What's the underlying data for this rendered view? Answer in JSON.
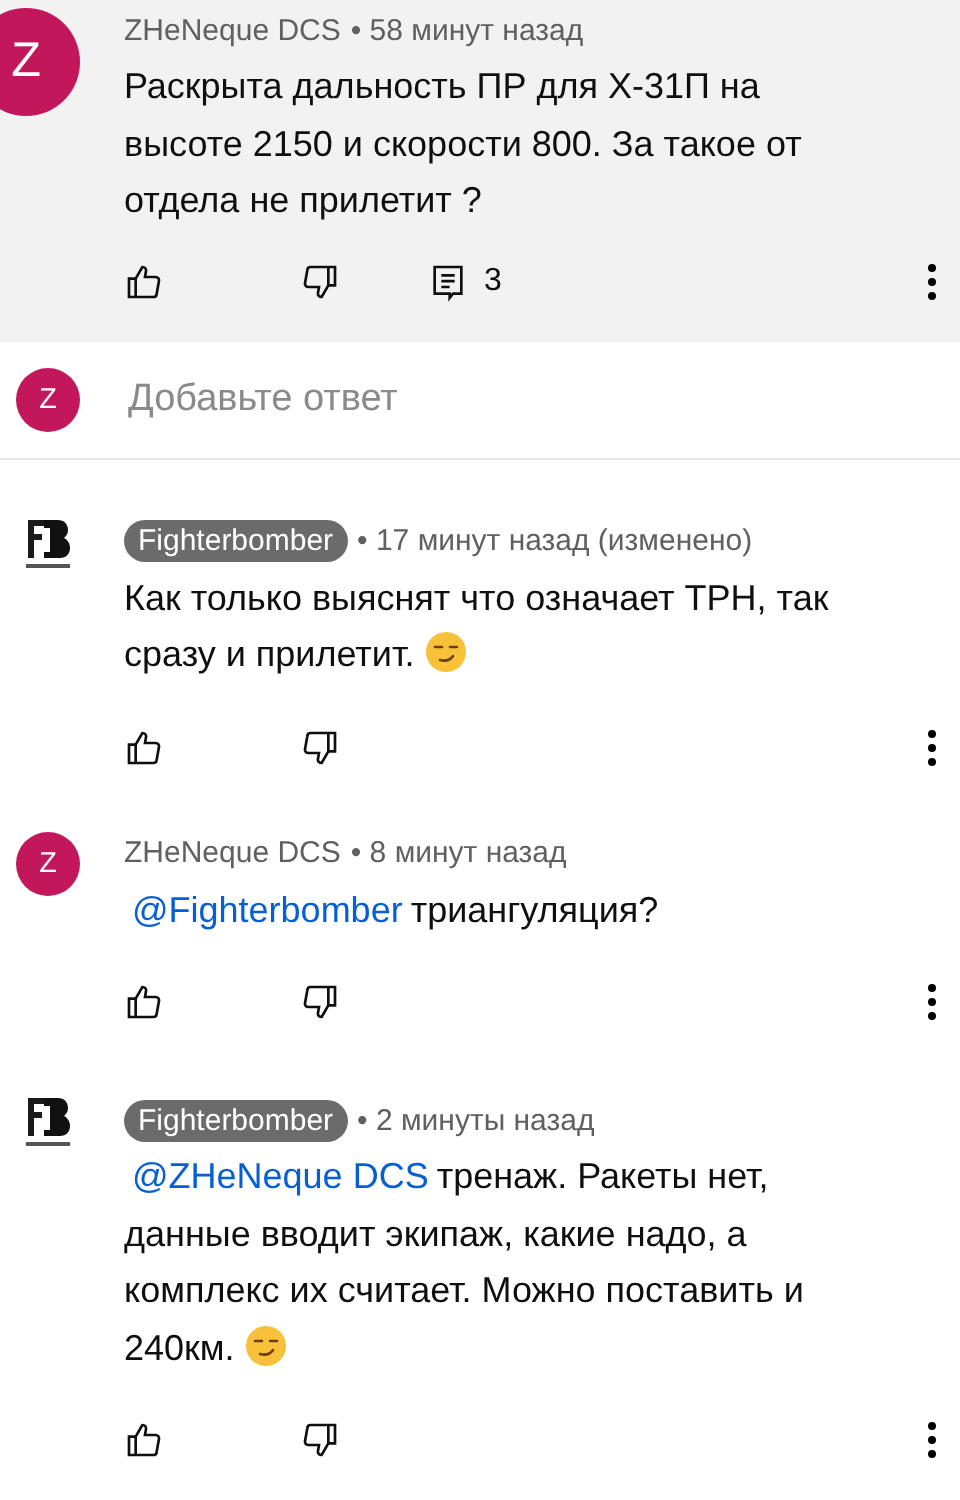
{
  "top_comment": {
    "avatar": {
      "kind": "letter",
      "letter": "Z",
      "color": "#c2185b"
    },
    "author": "ZHeNeque DCS",
    "owner": false,
    "meta": "• 58 минут назад",
    "body": {
      "text": "Раскрыта дальность ПР для Х-31П на высоте 2150 и скорости 800. За такое от отдела не прилетит ?",
      "emoji": false
    },
    "reply_count": "3"
  },
  "reply_input": {
    "avatar": {
      "kind": "letter",
      "letter": "Z",
      "color": "#c2185b"
    },
    "placeholder": "Добавьте ответ"
  },
  "replies": [
    {
      "avatar": {
        "kind": "logo"
      },
      "author": "Fighterbomber",
      "owner": true,
      "meta": "• 17 минут назад (изменено)",
      "body": {
        "text": "Как только выяснят что означает ТРН, так сразу и прилетит.",
        "emoji": true
      }
    },
    {
      "avatar": {
        "kind": "letter",
        "letter": "Z",
        "color": "#c2185b"
      },
      "author": "ZHeNeque DCS",
      "owner": false,
      "meta": "• 8 минут назад",
      "body": {
        "mention": "@Fighterbomber",
        "text": "триангуляция?",
        "emoji": false
      }
    },
    {
      "avatar": {
        "kind": "logo"
      },
      "author": "Fighterbomber",
      "owner": true,
      "meta": "• 2 минуты назад",
      "body": {
        "mention": "@ZHeNeque DCS",
        "text": "тренаж. Ракеты нет, данные вводит экипаж, какие надо, а комплекс их считает. Можно поставить и 240км.",
        "emoji": true
      }
    }
  ]
}
